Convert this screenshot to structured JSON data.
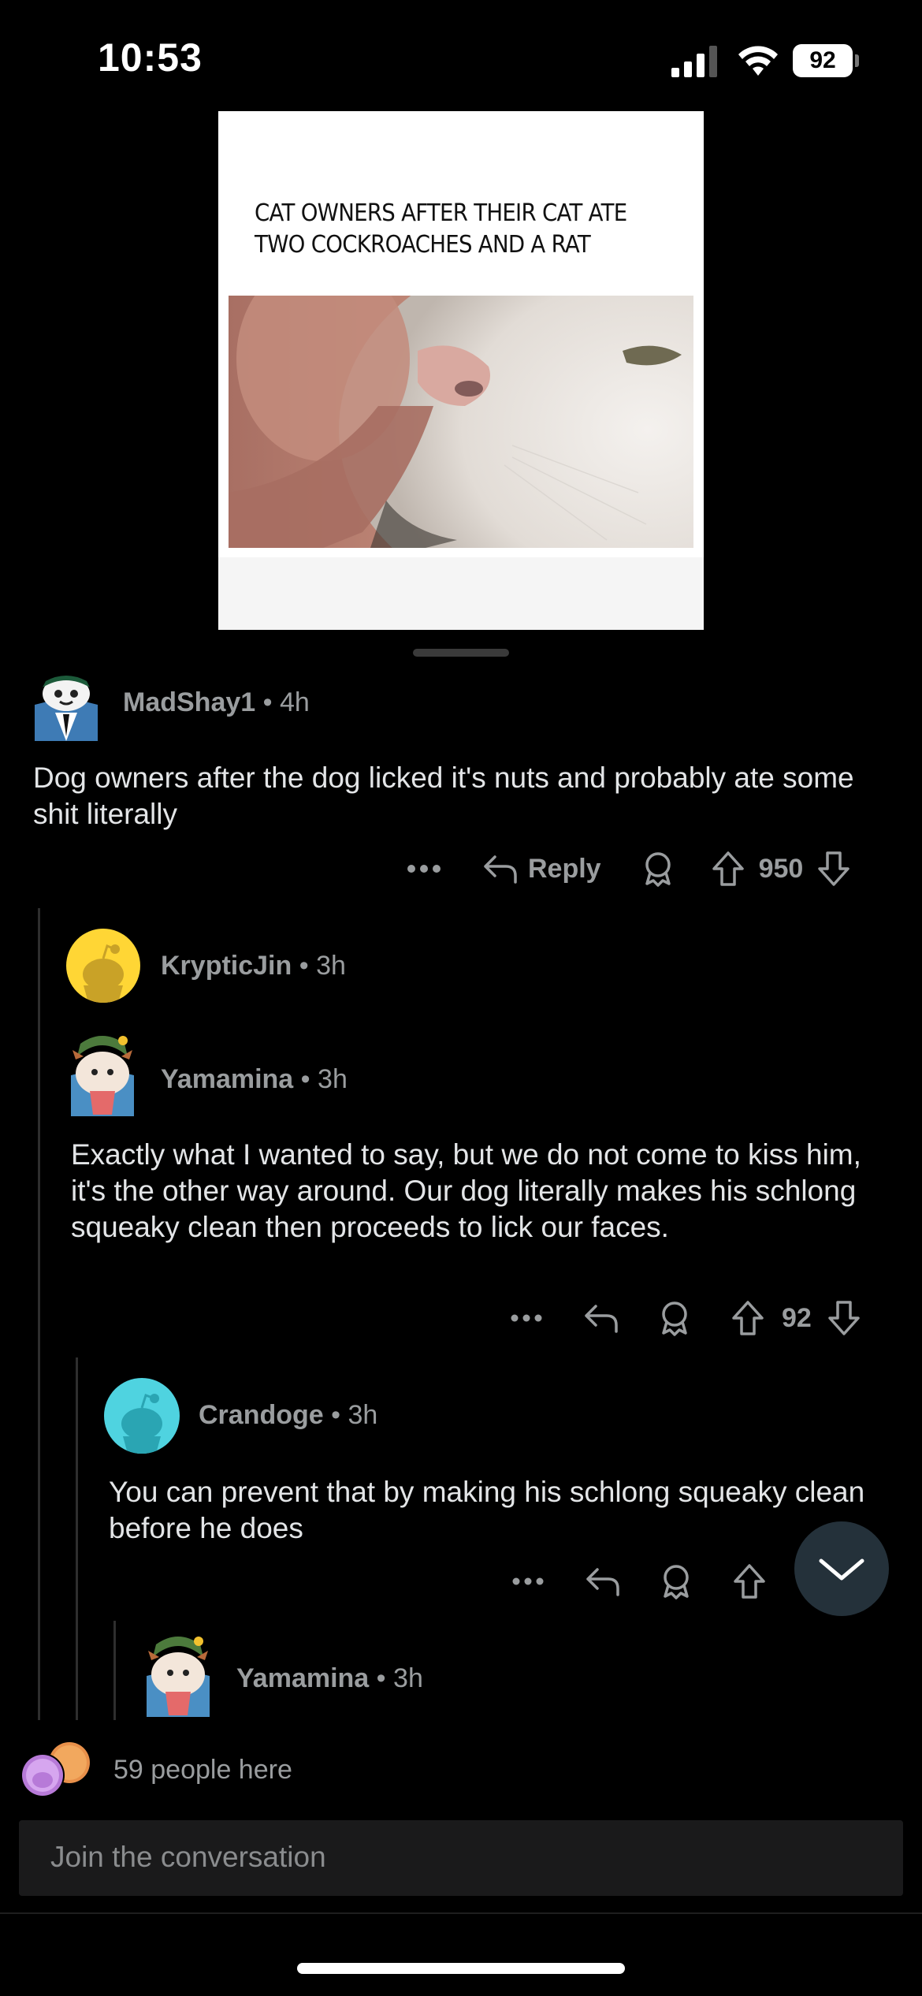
{
  "status_bar": {
    "time": "10:53",
    "battery": "92"
  },
  "post": {
    "meme_caption": "CAT OWNERS AFTER THEIR CAT ATE TWO COCKROACHES AND A RAT"
  },
  "comments": [
    {
      "user": "MadShay1",
      "sep": "•",
      "age": "4h",
      "text": "Dog owners after the dog licked it's nuts and probably ate some shit literally",
      "reply_label": "Reply",
      "votes": "950"
    },
    {
      "user": "KrypticJin",
      "sep": "•",
      "age": "3h"
    },
    {
      "user": "Yamamina",
      "sep": "•",
      "age": "3h",
      "text": "Exactly what I wanted to say, but we do not come to kiss him, it's the other way around. Our dog literally makes his schlong squeaky clean then proceeds to lick our faces.",
      "votes": "92"
    },
    {
      "user": "Crandoge",
      "sep": "•",
      "age": "3h",
      "text": "You can prevent that by making his schlong squeaky clean before he does"
    },
    {
      "user": "Yamamina",
      "sep": "•",
      "age": "3h"
    }
  ],
  "footer": {
    "people_here": "59 people here",
    "input_placeholder": "Join the conversation"
  },
  "colors": {
    "background": "#000000",
    "muted_text": "#9a9d9f",
    "body_text": "#e3e5e7",
    "input_bg": "#1a1a1b",
    "fab_bg": "#24313a"
  }
}
